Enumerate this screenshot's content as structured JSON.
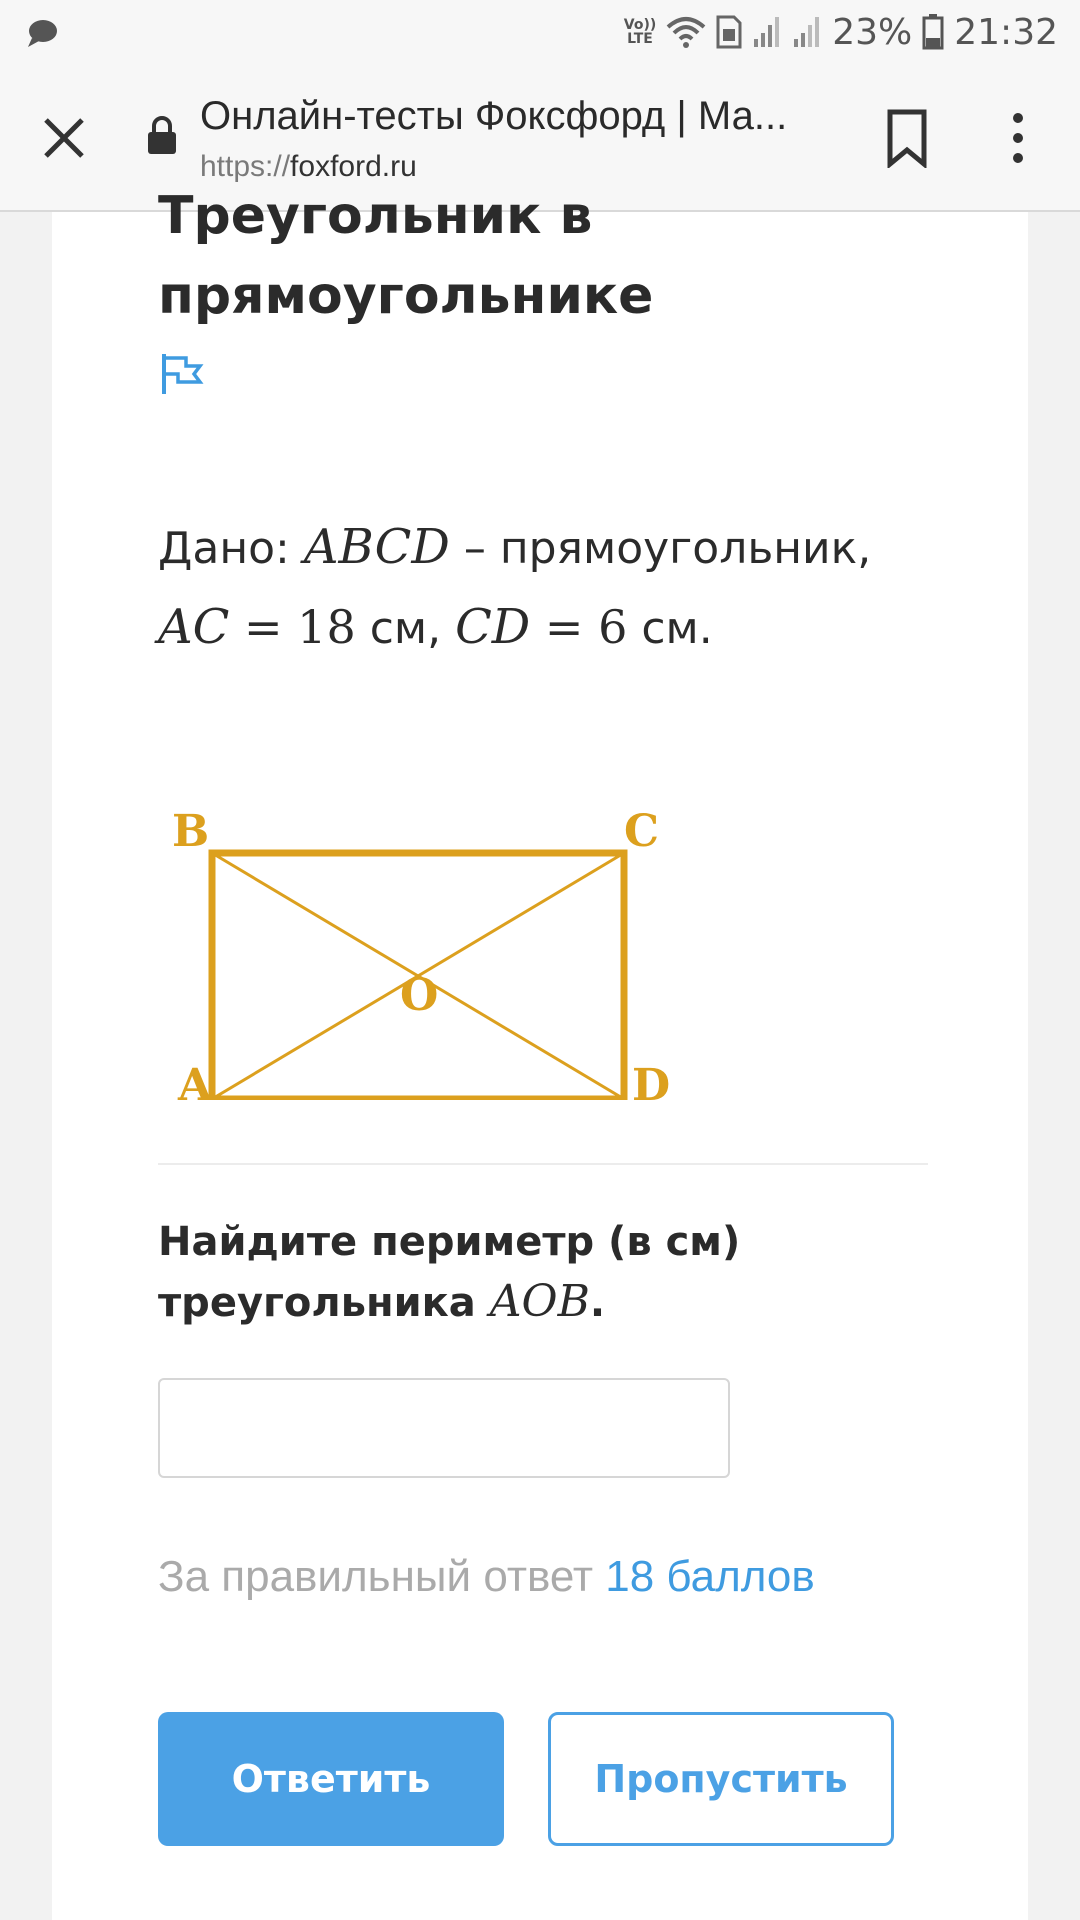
{
  "status_bar": {
    "battery": "23%",
    "time": "21:32",
    "network_label_top": "Vo))",
    "network_label_bottom": "LTE"
  },
  "browser": {
    "tab_title": "Онлайн-тесты Фоксфорд | Ма...",
    "url_scheme": "https://",
    "url_host": "foxford.ru"
  },
  "problem": {
    "heading": "Треугольник в прямоугольнике",
    "given_prefix": "Дано: ",
    "given_abcd": "ABCD",
    "given_dash": " – прямоугольник,",
    "given_ac": "AC",
    "given_eq1": " = 18",
    "given_unit1": " см, ",
    "given_cd": "CD",
    "given_eq2": " = 6",
    "given_unit2": " см.",
    "figure_labels": {
      "b": "B",
      "c": "C",
      "o": "O",
      "a": "A",
      "d": "D"
    },
    "figure_color": "#dca01e",
    "question_line1": "Найдите периметр (в см)",
    "question_line2": "треугольника ",
    "question_aob": "AOB",
    "question_end": ".",
    "answer_value": "",
    "points_label": "За правильный ответ ",
    "points_value": "18 баллов",
    "answer_button": "Ответить",
    "skip_button": "Пропустить"
  },
  "colors": {
    "accent": "#4ba1e5",
    "points_value": "#3f9be0",
    "muted_text": "#aaaaaa"
  }
}
